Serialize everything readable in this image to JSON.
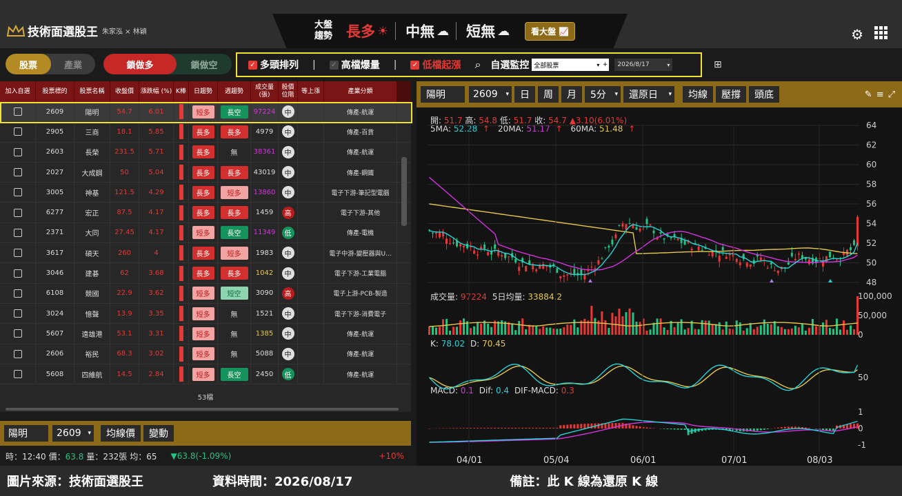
{
  "app": {
    "title": "技術面選股王",
    "subtitle": "朱家泓 × 林穎"
  },
  "trend": {
    "label": "大盤趨勢",
    "long": "長多",
    "mid": "中無",
    "short": "短無",
    "market_button": "看大盤"
  },
  "toolbar": {
    "tab_stock": "股票",
    "tab_industry": "產業",
    "tab_lock_long": "鎖做多",
    "tab_lock_short": "鎖做空",
    "filters": [
      {
        "label": "多頭排列",
        "checked": true
      },
      {
        "label": "高檔爆量",
        "checked": false
      },
      {
        "label": "低檔起漲",
        "checked": true
      }
    ],
    "watch_label": "自選監控",
    "watch_select": "全部股票",
    "date_select": "2026/8/17"
  },
  "table": {
    "headers": [
      "加入自選",
      "股票標的",
      "股票名稱",
      "收盤價",
      "漲跌幅 (%)",
      "K棒",
      "日趨勢",
      "週趨勢",
      "成交量 (張)",
      "股價 位階",
      "等上漲",
      "產業分類"
    ],
    "rows": [
      {
        "code": "2609",
        "name": "陽明",
        "close": "54.7",
        "chg": "6.01",
        "day": "短多",
        "week": "長空",
        "vol": "97224",
        "pos": "中",
        "ind": "傳產-航運"
      },
      {
        "code": "2905",
        "name": "三商",
        "close": "18.1",
        "chg": "5.85",
        "day": "長多",
        "week": "長多",
        "vol": "4979",
        "pos": "中",
        "ind": "傳產-百貨"
      },
      {
        "code": "2603",
        "name": "長榮",
        "close": "231.5",
        "chg": "5.71",
        "day": "長多",
        "week": "無",
        "vol": "38361",
        "pos": "中",
        "ind": "傳產-航運"
      },
      {
        "code": "2027",
        "name": "大成鋼",
        "close": "50",
        "chg": "5.04",
        "day": "長多",
        "week": "長多",
        "vol": "43019",
        "pos": "中",
        "ind": "傳產-鋼鐵"
      },
      {
        "code": "3005",
        "name": "神基",
        "close": "121.5",
        "chg": "4.29",
        "day": "長多",
        "week": "短多",
        "vol": "13860",
        "pos": "中",
        "ind": "電子下游-筆記型電腦"
      },
      {
        "code": "6277",
        "name": "宏正",
        "close": "87.5",
        "chg": "4.17",
        "day": "長多",
        "week": "長多",
        "vol": "1459",
        "pos": "高",
        "ind": "電子下游-其他"
      },
      {
        "code": "2371",
        "name": "大同",
        "close": "27.45",
        "chg": "4.17",
        "day": "短多",
        "week": "長空",
        "vol": "11349",
        "pos": "低",
        "ind": "傳產-電機"
      },
      {
        "code": "3617",
        "name": "碩天",
        "close": "260",
        "chg": "4",
        "day": "長多",
        "week": "短多",
        "vol": "1983",
        "pos": "中",
        "ind": "電子中游-變壓器與U..."
      },
      {
        "code": "3046",
        "name": "建碁",
        "close": "62",
        "chg": "3.68",
        "day": "長多",
        "week": "長多",
        "vol": "1042",
        "pos": "中",
        "ind": "電子下游-工業電腦"
      },
      {
        "code": "6108",
        "name": "競國",
        "close": "22.9",
        "chg": "3.62",
        "day": "短多",
        "week": "短空",
        "vol": "3090",
        "pos": "高",
        "ind": "電子上游-PCB-製造"
      },
      {
        "code": "3024",
        "name": "憶聲",
        "close": "13.9",
        "chg": "3.35",
        "day": "短多",
        "week": "無",
        "vol": "1521",
        "pos": "中",
        "ind": "電子下游-消費電子"
      },
      {
        "code": "5607",
        "name": "遠雄港",
        "close": "53.1",
        "chg": "3.31",
        "day": "短多",
        "week": "無",
        "vol": "1385",
        "pos": "中",
        "ind": "傳產-航運"
      },
      {
        "code": "2606",
        "name": "裕民",
        "close": "68.3",
        "chg": "3.02",
        "day": "短多",
        "week": "無",
        "vol": "5088",
        "pos": "中",
        "ind": "傳產-航運"
      },
      {
        "code": "5608",
        "name": "四維航",
        "close": "14.5",
        "chg": "2.84",
        "day": "短多",
        "week": "長空",
        "vol": "2450",
        "pos": "低",
        "ind": "傳產-航運"
      }
    ],
    "count": "53檔"
  },
  "stockbar": {
    "name": "陽明",
    "code": "2609",
    "btn1": "均線價",
    "btn2": "變動"
  },
  "ticker": {
    "time": "時：12:40",
    "price": "價：63.8",
    "vol": "量：232張",
    "avg": "均：65",
    "chg": "▼63.8(-1.09%)",
    "limit": "+10%"
  },
  "chart": {
    "name": "陽明",
    "code": "2609",
    "btn_day": "日",
    "btn_week": "周",
    "btn_month": "月",
    "period": "5分",
    "adjust": "還原日",
    "btn_ma": "均線",
    "btn_sr": "壓撐",
    "btn_top": "頭底",
    "ohlc": {
      "open_label": "開:",
      "open": "51.7",
      "high_label": "高:",
      "high": "54.8",
      "low_label": "低:",
      "low": "51.7",
      "close_label": "收:",
      "close": "54.7",
      "change": "▲3.10(6.01%)"
    },
    "ma": {
      "ma5_label": "5MA:",
      "ma5": "52.28",
      "ma20_label": "20MA:",
      "ma20": "51.17",
      "ma60_label": "60MA:",
      "ma60": "51.48",
      "arrow": "↑"
    },
    "price_ticks": [
      "64",
      "62",
      "60",
      "58",
      "56",
      "54",
      "52",
      "50",
      "48"
    ],
    "vol_label": "成交量:",
    "vol_value": "97224",
    "vol5_label": "5日均量:",
    "vol5_value": "33884.2",
    "vol_ticks": [
      "100,000",
      "50,000",
      "0"
    ],
    "kd": {
      "k_label": "K:",
      "k": "78.02",
      "d_label": "D:",
      "d": "70.45",
      "tick": "50"
    },
    "macd": {
      "label": "MACD:",
      "value": "0.1",
      "dif_label": "Dif:",
      "dif": "0.4",
      "diff_label": "DIF-MACD:",
      "diff": "0.3",
      "ticks": [
        "1",
        "0",
        "-1"
      ]
    },
    "dates": [
      "04/01",
      "05/04",
      "06/01",
      "07/01",
      "08/03"
    ]
  },
  "footer": {
    "source": "圖片來源：技術面選股王",
    "time": "資料時間：2026/08/17",
    "note": "備註：此 K 線為還原 K 線"
  },
  "colors": {
    "red": "#e53935",
    "green": "#26c281",
    "gold": "#8c6a17",
    "yellow": "#f1e232",
    "purple": "#d633e0",
    "cyan": "#27d3d8",
    "ma_yellow": "#e6c84b"
  }
}
